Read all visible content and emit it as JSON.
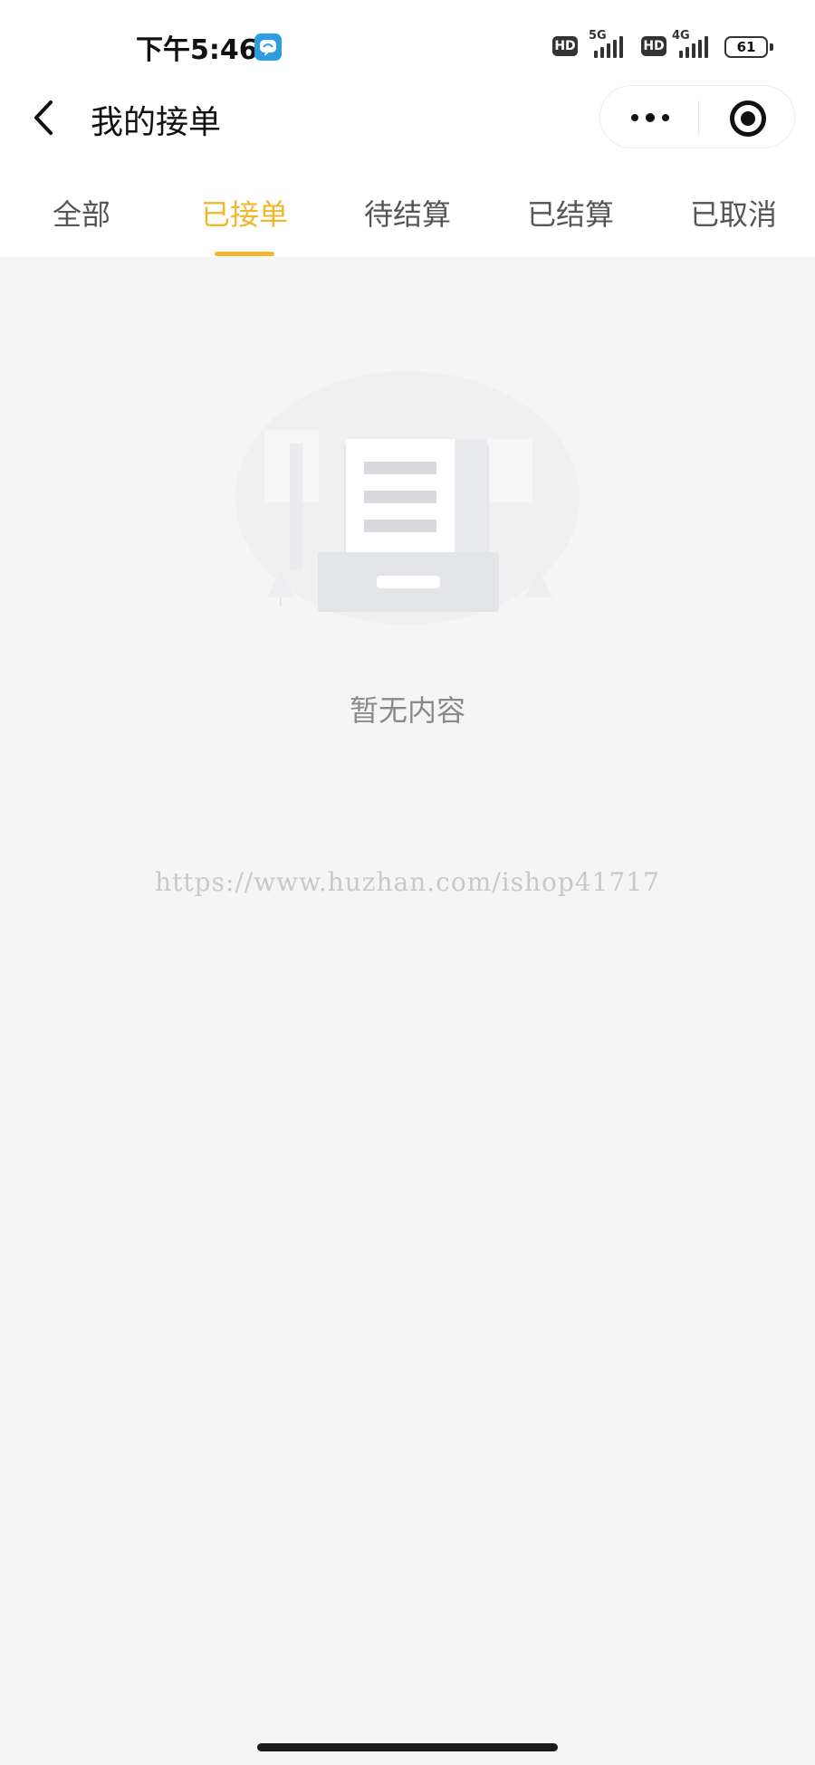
{
  "status_bar": {
    "time": "下午5:46",
    "network_1": "5G",
    "network_2": "4G",
    "hd_label": "HD",
    "battery": "61"
  },
  "nav": {
    "title": "我的接单",
    "back_icon": "chevron-left-icon",
    "more_icon": "more-dots-icon",
    "close_icon": "target-close-icon"
  },
  "tabs": {
    "items": [
      {
        "label": "全部"
      },
      {
        "label": "已接单"
      },
      {
        "label": "待结算"
      },
      {
        "label": "已结算"
      },
      {
        "label": "已取消"
      }
    ],
    "active_index": 1,
    "active_color": "#f0b72a"
  },
  "empty_state": {
    "message": "暂无内容",
    "illustration_icon": "empty-document-tray-icon"
  },
  "watermark": "https://www.huzhan.com/ishop41717"
}
